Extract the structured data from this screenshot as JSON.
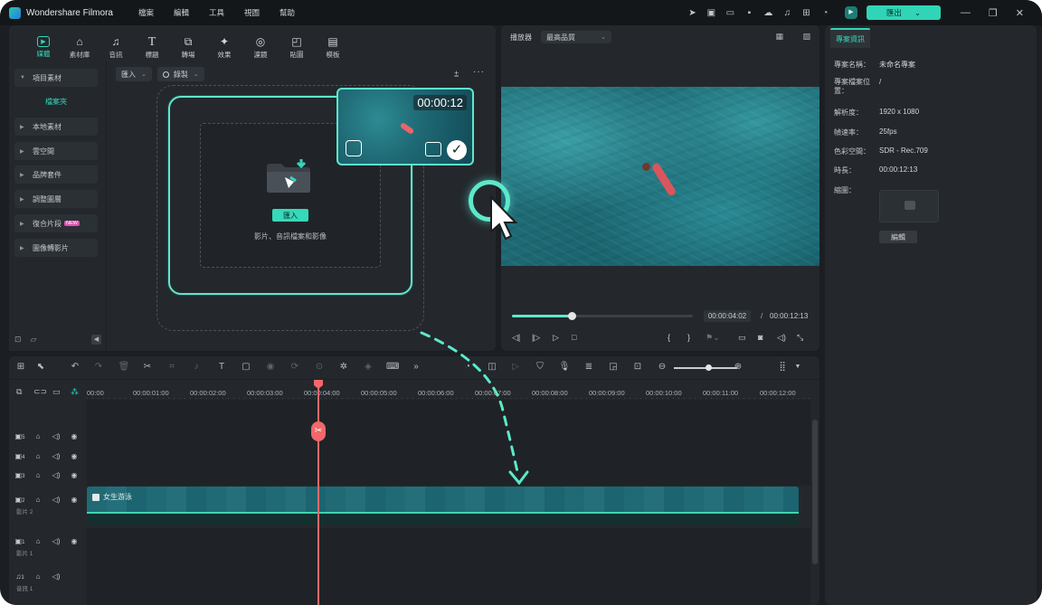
{
  "app": {
    "name": "Wondershare Filmora",
    "menu": [
      "檔案",
      "編輯",
      "工具",
      "視圖",
      "幫助"
    ],
    "export_label": "匯出",
    "avatar_letter": "",
    "colors": {
      "accent": "#35d5b9",
      "bg": "#1b1e22",
      "panel": "#24282d",
      "playhead": "#f0686a"
    }
  },
  "media_tabs": [
    {
      "label": "媒體",
      "icon": "media-icon",
      "active": true
    },
    {
      "label": "素材庫",
      "icon": "store-icon"
    },
    {
      "label": "音訊",
      "icon": "music-icon"
    },
    {
      "label": "標題",
      "icon": "title-icon"
    },
    {
      "label": "轉場",
      "icon": "transition-icon"
    },
    {
      "label": "效果",
      "icon": "effects-icon"
    },
    {
      "label": "濾鏡",
      "icon": "filter-icon"
    },
    {
      "label": "貼圖",
      "icon": "sticker-icon"
    },
    {
      "label": "模板",
      "icon": "template-icon"
    }
  ],
  "sidebar": {
    "project_media": "項目素材",
    "folder": "檔案夾",
    "items": [
      "本地素材",
      "雲空間",
      "品牌套件",
      "調整圖層",
      "復合片段",
      "圖像轉影片"
    ],
    "new_badge": "NEW"
  },
  "media_toolbar": {
    "import_label": "匯入",
    "record_label": "錄製"
  },
  "import_area": {
    "button": "匯入",
    "hint": "影片、音訊檔案和影像",
    "clip_timecode": "00:00:12"
  },
  "player": {
    "label": "播放器",
    "quality": "最高品質",
    "current_time": "00:00:04:02",
    "separator": "/",
    "total_time": "00:00:12:13",
    "progress": 0.33
  },
  "info": {
    "tab": "專案資訊",
    "rows": [
      {
        "label": "專案名稱：",
        "value": "未命名專案"
      },
      {
        "label": "專案檔案位置：",
        "value": "/"
      },
      {
        "label": "解析度：",
        "value": "1920 x 1080"
      },
      {
        "label": "幀速率：",
        "value": "25fps"
      },
      {
        "label": "色彩空間：",
        "value": "SDR - Rec.709"
      },
      {
        "label": "時長：",
        "value": "00:00:12:13"
      },
      {
        "label": "縮圖：",
        "value": ""
      }
    ],
    "edit_button": "編輯"
  },
  "timeline": {
    "ruler": [
      "00:00",
      "00:00:01:00",
      "00:00:02:00",
      "00:00:03:00",
      "00:00:04:00",
      "00:00:05:00",
      "00:00:06:00",
      "00:00:07:00",
      "00:00:08:00",
      "00:00:09:00",
      "00:00:10:00",
      "00:00:11:00",
      "00:00:12:00"
    ],
    "tracks": [
      {
        "num": "5",
        "name": ""
      },
      {
        "num": "4",
        "name": ""
      },
      {
        "num": "3",
        "name": ""
      },
      {
        "num": "2",
        "name": "影片 2"
      },
      {
        "num": "1",
        "name": "影片 1"
      },
      {
        "num": "1",
        "name": "音訊 1"
      }
    ],
    "clip_title": "女生游泳"
  }
}
